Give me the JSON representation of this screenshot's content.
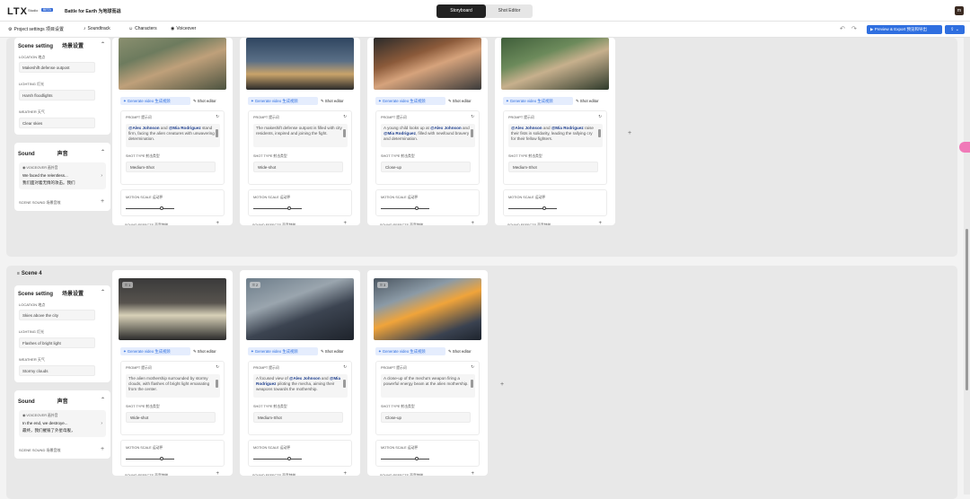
{
  "app": {
    "logo": "LTX",
    "logo_sub": "Studio",
    "beta": "BETA",
    "project": "Battle for Earth 为地球而战"
  },
  "tabs": {
    "storyboard": "Storyboard",
    "shot_editor": "Shot Editor"
  },
  "user": {
    "avatar": "m"
  },
  "toolbar": {
    "project_settings": "Project settings 项目设置",
    "soundtrack": "Soundtrack",
    "characters": "Characters",
    "voiceover": "Voiceover",
    "export": "Preview & Export 预览和导出"
  },
  "ui": {
    "scene_setting": "Scene setting",
    "scene_setting_cn": "场景设置",
    "location": "LOCATION 地点",
    "lighting": "LIGHTING 灯光",
    "weather": "WEATHER 天气",
    "sound": "Sound",
    "sound_cn": "声音",
    "voiceover": "VOICEOVER 画外音",
    "scene_sound": "SCENE SOUND 场景音效",
    "generate_video": "Generate video 生成视频",
    "shot_editor": "Shot editor",
    "prompt": "PROMPT 提示词",
    "shot_type": "SHOT TYPE 射击类型",
    "motion_scale": "MOTION SCALE 运动秤",
    "sound_effects": "SOUND EFFECTS 声音特效"
  },
  "scene3": {
    "location": "Makeshift defense outpost",
    "lighting": "Harsh floodlights",
    "weather": "Clear skies",
    "voiceover_en": "We faced the relentless...",
    "voiceover_cn": "我们面对着无情的攻击。我们",
    "shots": [
      {
        "prompt_mentions": [
          "@Alex Johnson",
          "@Mia Rodriguez"
        ],
        "prompt_and": " and ",
        "prompt_rest": " stand firm, facing the alien creatures with unwavering determination.",
        "shot_type": "Medium-Shot",
        "motion": 0.74
      },
      {
        "prompt_mentions": [],
        "prompt_and": "",
        "prompt_rest": "The makeshift defense outpost is filled with city residents, inspired and joining the fight.",
        "shot_type": "Wide-shot",
        "motion": 0.74
      },
      {
        "prompt_pre": "A young child looks up at ",
        "prompt_mentions": [
          "@Alex Johnson",
          "@Mia Rodriguez"
        ],
        "prompt_and": " and ",
        "prompt_rest": ", filled with newfound bravery and determination.",
        "shot_type": "Close-up",
        "motion": 0.74
      },
      {
        "prompt_mentions": [
          "@Alex Johnson",
          "@Mia Rodriguez"
        ],
        "prompt_and": " and ",
        "prompt_rest": " raise their fists in solidarity, leading the rallying cry for their fellow fighters.",
        "shot_type": "Medium-Shot",
        "motion": 0.74
      }
    ]
  },
  "scene4": {
    "title": "Scene 4",
    "location": "Skies above the city",
    "lighting": "Flashes of bright light",
    "weather": "Stormy clouds",
    "voiceover_en": "In the end, we destroye...",
    "voiceover_cn": "最终，我们摧毁了外星母舰，",
    "shots": [
      {
        "index": "1",
        "prompt_mentions": [],
        "prompt_and": "",
        "prompt_rest": "The alien mothership surrounded by stormy clouds, with flashes of bright light emanating from the center.",
        "shot_type": "Wide-shot",
        "motion": 0.74
      },
      {
        "index": "2",
        "prompt_pre": "A focused view of ",
        "prompt_mentions": [
          "@Alex Johnson",
          "@Mia Rodriguez"
        ],
        "prompt_and": " and ",
        "prompt_rest": " piloting the mecha, aiming their weapons towards the mothership.",
        "shot_type": "Medium-Shot",
        "motion": 0.74
      },
      {
        "index": "3",
        "prompt_mentions": [],
        "prompt_and": "",
        "prompt_rest": "A close-up of the mecha's weapon firing a powerful energy beam at the alien mothership.",
        "shot_type": "Close-up",
        "motion": 0.74
      }
    ]
  },
  "colors": {
    "accent": "#2f6fe0",
    "mention": "#1c3d8c",
    "brand_dark": "#222222"
  },
  "icons": [
    "gear-icon",
    "music-icon",
    "person-icon",
    "mic-icon",
    "undo-icon",
    "redo-icon",
    "play-icon",
    "share-icon",
    "refresh-icon",
    "chevron-up-icon",
    "plus-icon",
    "sparkle-icon",
    "edit-icon"
  ]
}
